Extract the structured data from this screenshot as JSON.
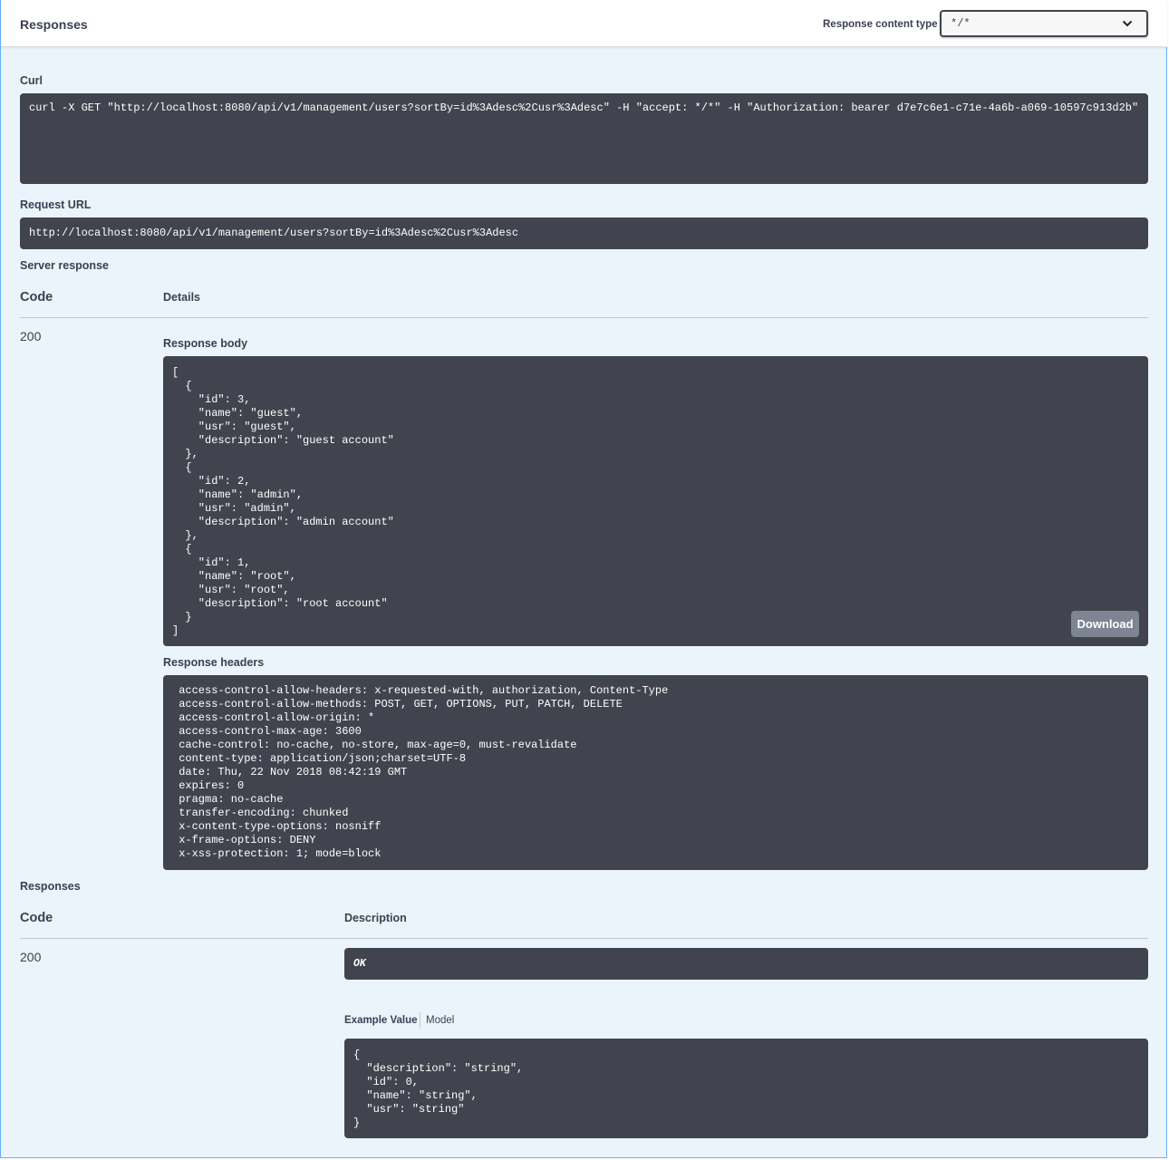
{
  "header": {
    "title": "Responses",
    "content_type_label": "Response content type",
    "content_type_value": "*/*"
  },
  "curl": {
    "label": "Curl",
    "command": "curl -X GET \"http://localhost:8080/api/v1/management/users?sortBy=id%3Adesc%2Cusr%3Adesc\" -H \"accept: */*\" -H \"Authorization: bearer d7e7c6e1-c71e-4a6b-a069-10597c913d2b\""
  },
  "request_url": {
    "label": "Request URL",
    "value": "http://localhost:8080/api/v1/management/users?sortBy=id%3Adesc%2Cusr%3Adesc"
  },
  "server_response": {
    "label": "Server response",
    "col_code": "Code",
    "col_details": "Details",
    "code": "200",
    "body_label": "Response body",
    "body": "[\n  {\n    \"id\": 3,\n    \"name\": \"guest\",\n    \"usr\": \"guest\",\n    \"description\": \"guest account\"\n  },\n  {\n    \"id\": 2,\n    \"name\": \"admin\",\n    \"usr\": \"admin\",\n    \"description\": \"admin account\"\n  },\n  {\n    \"id\": 1,\n    \"name\": \"root\",\n    \"usr\": \"root\",\n    \"description\": \"root account\"\n  }\n]",
    "download_label": "Download",
    "headers_label": "Response headers",
    "headers": " access-control-allow-headers: x-requested-with, authorization, Content-Type \n access-control-allow-methods: POST, GET, OPTIONS, PUT, PATCH, DELETE \n access-control-allow-origin: * \n access-control-max-age: 3600 \n cache-control: no-cache, no-store, max-age=0, must-revalidate \n content-type: application/json;charset=UTF-8 \n date: Thu, 22 Nov 2018 08:42:19 GMT \n expires: 0 \n pragma: no-cache \n transfer-encoding: chunked \n x-content-type-options: nosniff \n x-frame-options: DENY \n x-xss-protection: 1; mode=block "
  },
  "responses": {
    "label": "Responses",
    "col_code": "Code",
    "col_description": "Description",
    "code": "200",
    "description": "OK",
    "tab_example": "Example Value",
    "tab_model": "Model",
    "example": "{\n  \"description\": \"string\",\n  \"id\": 0,\n  \"name\": \"string\",\n  \"usr\": \"string\"\n}"
  }
}
